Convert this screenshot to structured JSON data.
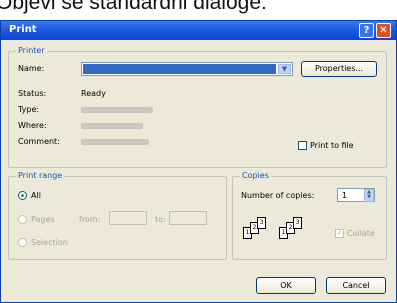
{
  "caption": "Objevi se standardni dialoge:",
  "window": {
    "title": "Print",
    "help_glyph": "?",
    "close_glyph": "✕"
  },
  "printer": {
    "legend": "Printer",
    "name_label": "Name:",
    "properties_label": "Properties...",
    "status_label": "Status:",
    "status_value": "Ready",
    "type_label": "Type:",
    "where_label": "Where:",
    "comment_label": "Comment:",
    "print_to_file_label": "Print to file",
    "print_to_file_checked": false
  },
  "print_range": {
    "legend": "Print range",
    "all_label": "All",
    "pages_label": "Pages",
    "from_label": "from:",
    "to_label": "to:",
    "selection_label": "Selection",
    "selected": "all"
  },
  "copies": {
    "legend": "Copies",
    "number_label": "Number of copies:",
    "number_value": "1",
    "collate_label": "Collate",
    "collate_checked": true,
    "page_numbers": [
      "1",
      "2",
      "3"
    ]
  },
  "buttons": {
    "ok": "OK",
    "cancel": "Cancel"
  },
  "colors": {
    "titlebar": "#0b47d1",
    "legend": "#1b52b8",
    "selection": "#316ac5"
  }
}
